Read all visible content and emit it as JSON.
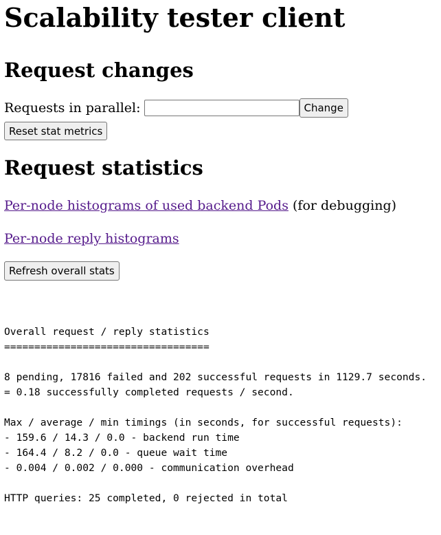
{
  "page": {
    "title": "Scalability tester client"
  },
  "request_changes": {
    "heading": "Request changes",
    "parallel_label": "Requests in parallel:",
    "parallel_value": "",
    "change_button": "Change",
    "reset_button": "Reset stat metrics"
  },
  "request_statistics": {
    "heading": "Request statistics",
    "backend_link": "Per-node histograms of used backend Pods",
    "backend_note": " (for debugging)",
    "reply_link": "Per-node reply histograms",
    "refresh_button": "Refresh overall stats"
  },
  "stats_output": {
    "lines": [
      "Overall request / reply statistics",
      "==================================",
      "",
      "8 pending, 17816 failed and 202 successful requests in 1129.7 seconds.",
      "= 0.18 successfully completed requests / second.",
      "",
      "Max / average / min timings (in seconds, for successful requests):",
      "- 159.6 / 14.3 / 0.0 - backend run time",
      "- 164.4 / 8.2 / 0.0 - queue wait time",
      "- 0.004 / 0.002 / 0.000 - communication overhead",
      "",
      "HTTP queries: 25 completed, 0 rejected in total"
    ]
  },
  "colors": {
    "visited_link": "#551a8b",
    "button_bg": "#efefef",
    "button_border": "#767676"
  }
}
